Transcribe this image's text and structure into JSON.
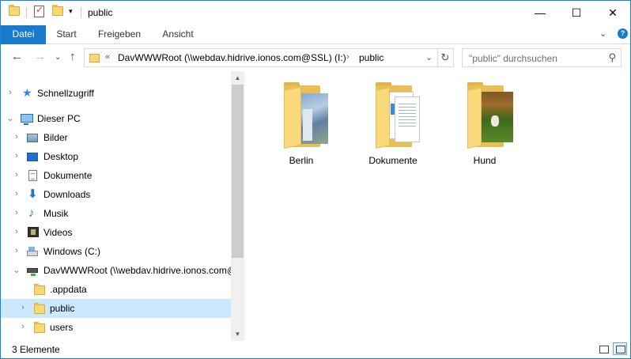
{
  "window": {
    "title": "public",
    "minimize_glyph": "—",
    "maximize_glyph": "☐",
    "close_glyph": "✕"
  },
  "ribbon": {
    "tabs": [
      "Datei",
      "Start",
      "Freigeben",
      "Ansicht"
    ],
    "collapse_glyph": "⌄",
    "help_glyph": "?"
  },
  "address": {
    "overflow": "«",
    "crumbs": [
      "DavWWWRoot (\\\\webdav.hidrive.ionos.com@SSL) (I:)",
      "public"
    ],
    "separator": "›",
    "dropdown_glyph": "⌄",
    "refresh_glyph": "↻",
    "back_glyph": "←",
    "forward_glyph": "→",
    "recent_glyph": "⌄",
    "up_glyph": "↑"
  },
  "search": {
    "placeholder": "\"public\" durchsuchen",
    "icon_glyph": "⚲"
  },
  "nav": {
    "items": [
      {
        "label": "Schnellzugriff",
        "icon": "star-icon",
        "arrow": "›"
      },
      {
        "label": "Dieser PC",
        "icon": "pc-icon",
        "arrow": "⌄"
      },
      {
        "label": "Bilder",
        "icon": "pictures-icon",
        "arrow": "›"
      },
      {
        "label": "Desktop",
        "icon": "desktop-icon",
        "arrow": "›"
      },
      {
        "label": "Dokumente",
        "icon": "documents-icon",
        "arrow": "›"
      },
      {
        "label": "Downloads",
        "icon": "downloads-icon",
        "arrow": "›"
      },
      {
        "label": "Musik",
        "icon": "music-icon",
        "arrow": "›"
      },
      {
        "label": "Videos",
        "icon": "videos-icon",
        "arrow": "›"
      },
      {
        "label": "Windows (C:)",
        "icon": "drive-icon",
        "arrow": "›"
      },
      {
        "label": "DavWWWRoot (\\\\webdav.hidrive.ionos.com@",
        "icon": "network-drive-icon",
        "arrow": "⌄"
      },
      {
        "label": ".appdata",
        "icon": "folder-icon",
        "arrow": ""
      },
      {
        "label": "public",
        "icon": "folder-icon",
        "arrow": "›"
      },
      {
        "label": "users",
        "icon": "folder-icon",
        "arrow": "›"
      }
    ],
    "selected": "public"
  },
  "content": {
    "items": [
      {
        "label": "Berlin",
        "icon": "folder-photo-icon"
      },
      {
        "label": "Dokumente",
        "icon": "folder-documents-icon"
      },
      {
        "label": "Hund",
        "icon": "folder-photo-icon"
      }
    ]
  },
  "status": {
    "item_count": "3 Elemente"
  },
  "colors": {
    "accent": "#1979ca",
    "selection": "#cce8ff",
    "folder": "#f8d775"
  },
  "glyphs": {
    "scroll_up": "▲",
    "scroll_down": "▼",
    "star": "★",
    "download": "⬇",
    "music": "♪",
    "checkmark": "✓",
    "qat_dropdown": "▾"
  }
}
